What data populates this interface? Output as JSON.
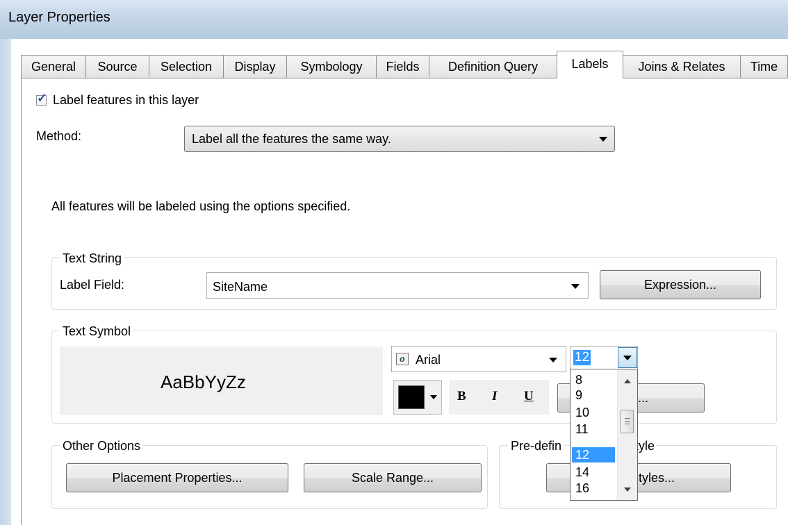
{
  "window": {
    "title": "Layer Properties"
  },
  "tabs": [
    {
      "label": "General"
    },
    {
      "label": "Source"
    },
    {
      "label": "Selection"
    },
    {
      "label": "Display"
    },
    {
      "label": "Symbology"
    },
    {
      "label": "Fields"
    },
    {
      "label": "Definition Query"
    },
    {
      "label": "Labels",
      "active": true
    },
    {
      "label": "Joins & Relates"
    },
    {
      "label": "Time"
    }
  ],
  "labels_tab": {
    "label_features_checkbox": {
      "label": "Label features in this layer",
      "checked": true
    },
    "method": {
      "label": "Method:",
      "value": "Label all the features the same way."
    },
    "description": "All features will be labeled using the options specified.",
    "text_string": {
      "group_label": "Text String",
      "label_field_label": "Label Field:",
      "label_field_value": "SiteName",
      "expression_button": "Expression..."
    },
    "text_symbol": {
      "group_label": "Text Symbol",
      "preview_text": "AaBbYyZz",
      "font": "Arial",
      "size": "12",
      "color": "#000000",
      "bold": "B",
      "italic": "I",
      "underline": "U",
      "symbol_button_visible": "l...."
    },
    "other_options": {
      "group_label": "Other Options",
      "placement_button": "Placement Properties...",
      "scale_range_button": "Scale Range..."
    },
    "predefined_style": {
      "group_label_left": "Pre-defin",
      "group_label_right": "tyle",
      "label_styles_button_visible": "tyles..."
    },
    "size_dropdown": {
      "options": [
        "8",
        "9",
        "10",
        "11",
        "12",
        "14",
        "16"
      ],
      "selected": "12"
    }
  },
  "icons": {
    "font_type_icon": "opentype-o-icon",
    "chevron": "chevron-down-icon"
  }
}
